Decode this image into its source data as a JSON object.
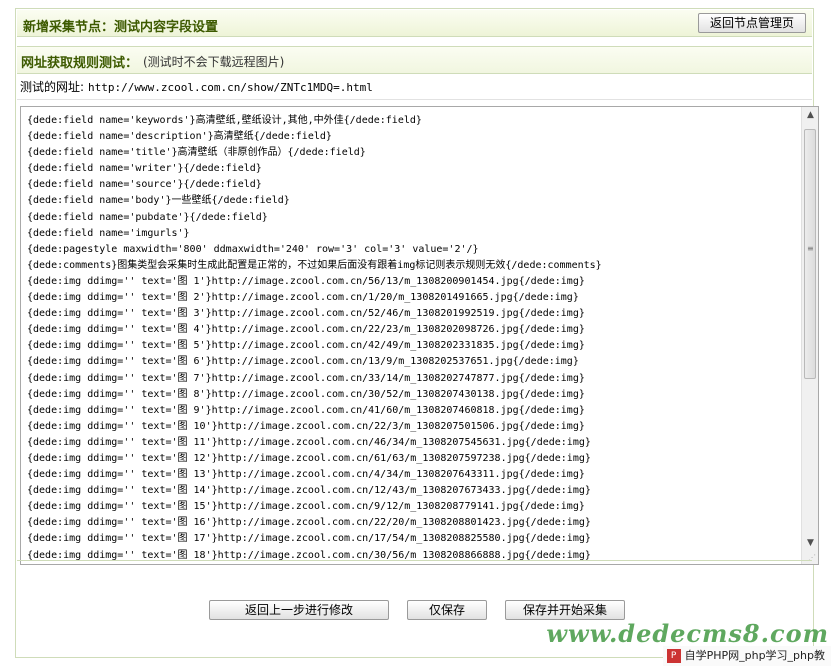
{
  "header": {
    "title": "新增采集节点：测试内容字段设置",
    "back_button": "返回节点管理页"
  },
  "rule_test": {
    "title": "网址获取规则测试：",
    "note": "(测试时不会下载远程图片)"
  },
  "test_url": {
    "label": "测试的网址:",
    "value": "http://www.zcool.com.cn/show/ZNTc1MDQ=.html"
  },
  "result_lines": [
    "{dede:field name='keywords'}高清壁纸,壁纸设计,其他,中外佳{/dede:field}",
    "{dede:field name='description'}高清壁纸{/dede:field}",
    "{dede:field name='title'}高清壁纸（非原创作品）{/dede:field}",
    "{dede:field name='writer'}{/dede:field}",
    "{dede:field name='source'}{/dede:field}",
    "{dede:field name='body'}一些壁纸{/dede:field}",
    "{dede:field name='pubdate'}{/dede:field}",
    "{dede:field name='imgurls'}",
    "{dede:pagestyle maxwidth='800' ddmaxwidth='240' row='3' col='3' value='2'/}",
    "{dede:comments}图集类型会采集时生成此配置是正常的，不过如果后面没有跟着img标记则表示规则无效{/dede:comments}",
    "{dede:img ddimg='' text='图 1'}http://image.zcool.com.cn/56/13/m_1308200901454.jpg{/dede:img}",
    "{dede:img ddimg='' text='图 2'}http://image.zcool.com.cn/1/20/m_1308201491665.jpg{/dede:img}",
    "{dede:img ddimg='' text='图 3'}http://image.zcool.com.cn/52/46/m_1308201992519.jpg{/dede:img}",
    "{dede:img ddimg='' text='图 4'}http://image.zcool.com.cn/22/23/m_1308202098726.jpg{/dede:img}",
    "{dede:img ddimg='' text='图 5'}http://image.zcool.com.cn/42/49/m_1308202331835.jpg{/dede:img}",
    "{dede:img ddimg='' text='图 6'}http://image.zcool.com.cn/13/9/m_1308202537651.jpg{/dede:img}",
    "{dede:img ddimg='' text='图 7'}http://image.zcool.com.cn/33/14/m_1308202747877.jpg{/dede:img}",
    "{dede:img ddimg='' text='图 8'}http://image.zcool.com.cn/30/52/m_1308207430138.jpg{/dede:img}",
    "{dede:img ddimg='' text='图 9'}http://image.zcool.com.cn/41/60/m_1308207460818.jpg{/dede:img}",
    "{dede:img ddimg='' text='图 10'}http://image.zcool.com.cn/22/3/m_1308207501506.jpg{/dede:img}",
    "{dede:img ddimg='' text='图 11'}http://image.zcool.com.cn/46/34/m_1308207545631.jpg{/dede:img}",
    "{dede:img ddimg='' text='图 12'}http://image.zcool.com.cn/61/63/m_1308207597238.jpg{/dede:img}",
    "{dede:img ddimg='' text='图 13'}http://image.zcool.com.cn/4/34/m_1308207643311.jpg{/dede:img}",
    "{dede:img ddimg='' text='图 14'}http://image.zcool.com.cn/12/43/m_1308207673433.jpg{/dede:img}",
    "{dede:img ddimg='' text='图 15'}http://image.zcool.com.cn/9/12/m_1308208779141.jpg{/dede:img}",
    "{dede:img ddimg='' text='图 16'}http://image.zcool.com.cn/22/20/m_1308208801423.jpg{/dede:img}",
    "{dede:img ddimg='' text='图 17'}http://image.zcool.com.cn/17/54/m_1308208825580.jpg{/dede:img}",
    "{dede:img ddimg='' text='图 18'}http://image.zcool.com.cn/30/56/m_1308208866888.jpg{/dede:img}"
  ],
  "buttons": {
    "modify": "返回上一步进行修改",
    "save_only": "仅保存",
    "save_and_start": "保存并开始采集"
  },
  "watermark": "www.dedecms8.com",
  "site_badge": "自学PHP网_php学习_php教",
  "icons": {
    "scroll_up": "triangle-up-icon",
    "scroll_down": "triangle-down-icon",
    "resize": "resize-grip-icon"
  }
}
